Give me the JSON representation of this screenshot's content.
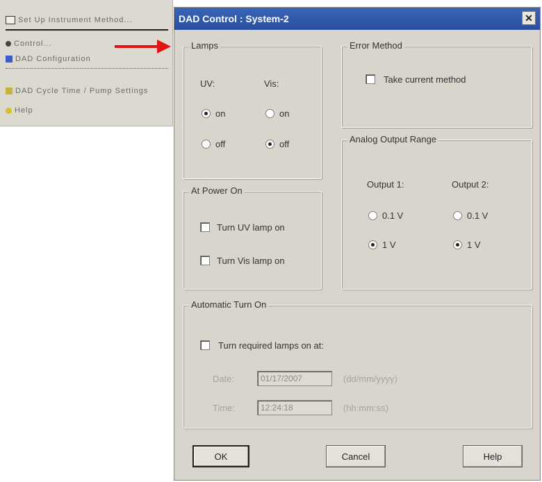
{
  "dialog": {
    "title": "DAD Control : System-2",
    "close_glyph": "✕",
    "lamps": {
      "legend": "Lamps",
      "uv_header": "UV:",
      "vis_header": "Vis:",
      "on_label": "on",
      "off_label": "off",
      "uv_state": "on",
      "vis_state": "off"
    },
    "error_method": {
      "legend": "Error Method",
      "take_current_label": "Take current method",
      "take_current_checked": false
    },
    "at_power_on": {
      "legend": "At Power On",
      "turn_uv_label": "Turn UV lamp on",
      "turn_vis_label": "Turn Vis lamp on"
    },
    "analog_output": {
      "legend": "Analog Output Range",
      "output1_header": "Output 1:",
      "output2_header": "Output 2:",
      "opt_low": "0.1 V",
      "opt_high": "1 V",
      "output1_selected": "1 V",
      "output2_selected": "1 V"
    },
    "automatic_turn_on": {
      "legend": "Automatic Turn On",
      "turn_required_label": "Turn required lamps on at:",
      "date_label": "Date:",
      "time_label": "Time:",
      "date_value": "01/17/2007",
      "time_value": "12:24:18",
      "date_format": "(dd/mm/yyyy)",
      "time_format": "(hh:mm:ss)"
    },
    "buttons": {
      "ok": "OK",
      "cancel": "Cancel",
      "help": "Help"
    }
  },
  "menu_snippet": {
    "items": [
      "Set Up Instrument Method...",
      "Control...",
      "DAD Configuration",
      "DAD Cycle Time / Pump Settings",
      "Help"
    ]
  },
  "colors": {
    "arrow": "#e41414",
    "titlebar": "#2f58a8",
    "dialog_bg": "#d9d5cc"
  }
}
